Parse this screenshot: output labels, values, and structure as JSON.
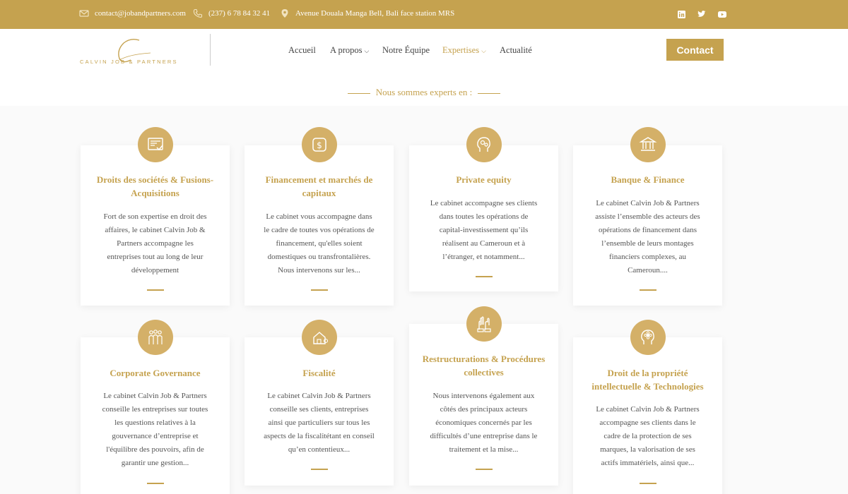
{
  "topbar": {
    "email": "contact@jobandpartners.com",
    "phone": "(237) 6 78 84 32 41",
    "address": "Avenue Douala Manga Bell, Bali face station MRS"
  },
  "header": {
    "logo_text": "CALVIN JOB & PARTNERS",
    "nav": [
      {
        "label": "Accueil"
      },
      {
        "label": "A propos"
      },
      {
        "label": "Notre Équipe"
      },
      {
        "label": "Expertises"
      },
      {
        "label": "Actualité"
      }
    ],
    "contact_label": "Contact"
  },
  "section": {
    "title": "Nous sommes experts en :"
  },
  "cards": [
    {
      "title": "Droits  des sociétés & Fusions-Acquisitions",
      "icon": "document-check-icon",
      "desc": [
        "Fort de son expertise en droit des",
        "affaires, le cabinet Calvin Job &",
        "Partners accompagne les",
        "entreprises tout au long de leur",
        "développement"
      ]
    },
    {
      "title": "Financement et marchés de capitaux",
      "icon": "dollar-icon",
      "desc": [
        "Le cabinet vous accompagne dans",
        "le cadre de toutes vos opérations de",
        "financement, qu'elles soient",
        "domestiques ou transfrontalières.",
        "Nous intervenons sur les..."
      ]
    },
    {
      "title": "Private equity",
      "icon": "head-gears-icon",
      "desc": [
        "Le cabinet accompagne ses clients",
        "dans toutes les opérations de",
        "capital-investissement qu’ils",
        "réalisent au Cameroun et à",
        "l’étranger, et notamment..."
      ]
    },
    {
      "title": "Banque & Finance",
      "icon": "bank-icon",
      "desc": [
        "Le cabinet Calvin Job & Partners",
        "assiste l’ensemble des acteurs des",
        "opérations de financement dans",
        "l’ensemble de leurs montages",
        "financiers complexes, au",
        "Cameroun...."
      ]
    },
    {
      "title": "Corporate Governance",
      "icon": "group-icon",
      "desc": [
        "Le cabinet Calvin Job & Partners",
        "conseille les entreprises sur toutes",
        "les questions relatives à la",
        "gouvernance d’entreprise et",
        "l'équilibre des pouvoirs, afin de",
        "garantir une gestion..."
      ]
    },
    {
      "title": "Fiscalité",
      "icon": "house-tree-icon",
      "desc": [
        "Le cabinet Calvin Job & Partners",
        "conseille ses clients, entreprises",
        "ainsi que particuliers sur tous les",
        "aspects de la fiscalitétant en conseil",
        "qu’en contentieux..."
      ]
    },
    {
      "title": "Restructurations & Procédures collectives",
      "icon": "hands-icon",
      "desc": [
        "Nous intervenons également aux",
        "côtés des principaux acteurs",
        "économiques concernés par les",
        "difficultés d’une entreprise dans le",
        "traitement et la mise..."
      ]
    },
    {
      "title": "Droit de la propriété intellectuelle & Technologies",
      "icon": "head-flower-icon",
      "desc": [
        "Le cabinet Calvin Job & Partners",
        "accompagne ses clients dans le",
        "cadre de la protection de ses",
        "marques, la valorisation de ses",
        "actifs immatériels, ainsi que..."
      ]
    }
  ],
  "colors": {
    "accent": "#c5a24f",
    "icon_bg": "#d4b068"
  }
}
